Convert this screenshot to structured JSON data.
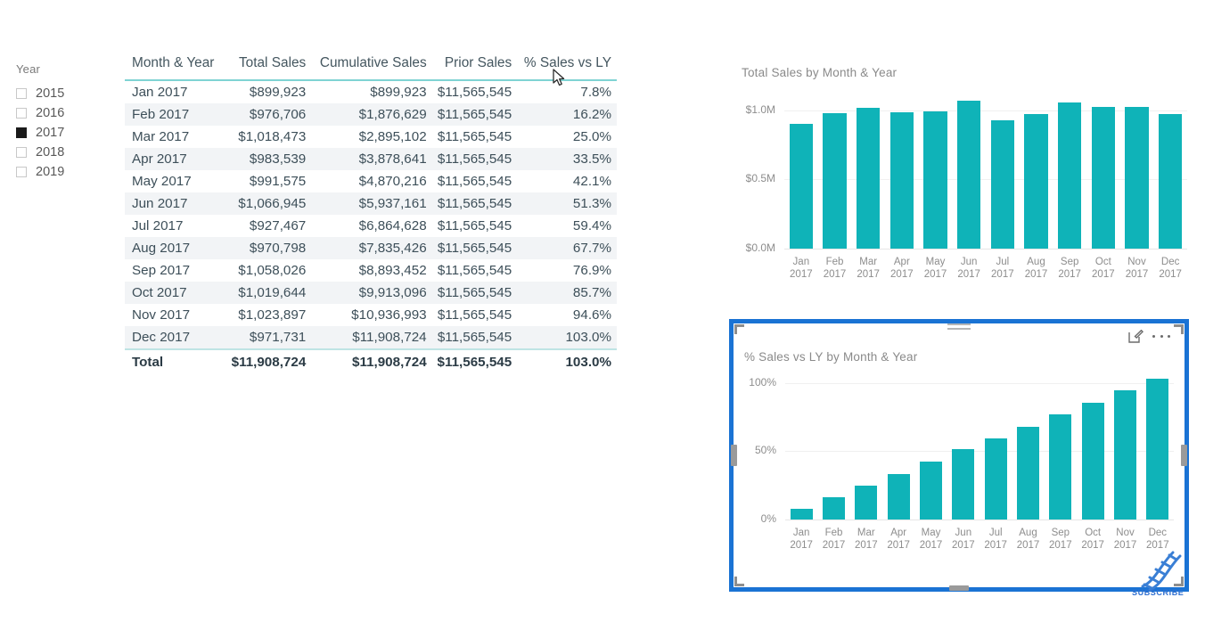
{
  "slicer": {
    "title": "Year",
    "items": [
      {
        "label": "2015",
        "checked": false
      },
      {
        "label": "2016",
        "checked": false
      },
      {
        "label": "2017",
        "checked": true
      },
      {
        "label": "2018",
        "checked": false
      },
      {
        "label": "2019",
        "checked": false
      }
    ]
  },
  "table": {
    "headers": [
      "Month & Year",
      "Total Sales",
      "Cumulative Sales",
      "Prior Sales",
      "% Sales vs LY"
    ],
    "rows": [
      [
        "Jan 2017",
        "$899,923",
        "$899,923",
        "$11,565,545",
        "7.8%"
      ],
      [
        "Feb 2017",
        "$976,706",
        "$1,876,629",
        "$11,565,545",
        "16.2%"
      ],
      [
        "Mar 2017",
        "$1,018,473",
        "$2,895,102",
        "$11,565,545",
        "25.0%"
      ],
      [
        "Apr 2017",
        "$983,539",
        "$3,878,641",
        "$11,565,545",
        "33.5%"
      ],
      [
        "May 2017",
        "$991,575",
        "$4,870,216",
        "$11,565,545",
        "42.1%"
      ],
      [
        "Jun 2017",
        "$1,066,945",
        "$5,937,161",
        "$11,565,545",
        "51.3%"
      ],
      [
        "Jul 2017",
        "$927,467",
        "$6,864,628",
        "$11,565,545",
        "59.4%"
      ],
      [
        "Aug 2017",
        "$970,798",
        "$7,835,426",
        "$11,565,545",
        "67.7%"
      ],
      [
        "Sep 2017",
        "$1,058,026",
        "$8,893,452",
        "$11,565,545",
        "76.9%"
      ],
      [
        "Oct 2017",
        "$1,019,644",
        "$9,913,096",
        "$11,565,545",
        "85.7%"
      ],
      [
        "Nov 2017",
        "$1,023,897",
        "$10,936,993",
        "$11,565,545",
        "94.6%"
      ],
      [
        "Dec 2017",
        "$971,731",
        "$11,908,724",
        "$11,565,545",
        "103.0%"
      ]
    ],
    "total_row": [
      "Total",
      "$11,908,724",
      "$11,908,724",
      "$11,565,545",
      "103.0%"
    ]
  },
  "visual_header": {
    "focus_icon": "focus-mode-icon",
    "more_icon": "more-options-icon"
  },
  "watermark": {
    "logo": "dna-helix-icon",
    "text": "SUBSCRIBE"
  },
  "cursor": {
    "icon": "mouse-pointer-icon"
  },
  "colors": {
    "bar": "#0fb3b8",
    "selection": "#1a73d4",
    "header_rule": "#7fd3d3",
    "band": "#f2f4f6"
  },
  "chart_data": [
    {
      "id": "total_sales_by_month",
      "type": "bar",
      "title": "Total Sales by Month & Year",
      "xlabel": "",
      "ylabel": "",
      "categories": [
        "Jan\n2017",
        "Feb\n2017",
        "Mar\n2017",
        "Apr\n2017",
        "May\n2017",
        "Jun\n2017",
        "Jul\n2017",
        "Aug\n2017",
        "Sep\n2017",
        "Oct\n2017",
        "Nov\n2017",
        "Dec\n2017"
      ],
      "values": [
        899923,
        976706,
        1018473,
        983539,
        991575,
        1066945,
        927467,
        970798,
        1058026,
        1019644,
        1023897,
        971731
      ],
      "ylim": [
        0,
        1100000
      ],
      "yticks": [
        0,
        500000,
        1000000
      ],
      "ytick_labels": [
        "$0.0M",
        "$0.5M",
        "$1.0M"
      ],
      "grid": true,
      "legend": "none",
      "color": "#0fb3b8"
    },
    {
      "id": "pct_sales_vs_ly_by_month",
      "type": "bar",
      "title": "% Sales vs LY by Month & Year",
      "xlabel": "",
      "ylabel": "",
      "categories": [
        "Jan\n2017",
        "Feb\n2017",
        "Mar\n2017",
        "Apr\n2017",
        "May\n2017",
        "Jun\n2017",
        "Jul\n2017",
        "Aug\n2017",
        "Sep\n2017",
        "Oct\n2017",
        "Nov\n2017",
        "Dec\n2017"
      ],
      "values": [
        7.8,
        16.2,
        25.0,
        33.5,
        42.1,
        51.3,
        59.4,
        67.7,
        76.9,
        85.7,
        94.6,
        103.0
      ],
      "ylim": [
        0,
        103.0
      ],
      "yticks": [
        0,
        50,
        100
      ],
      "ytick_labels": [
        "0%",
        "50%",
        "100%"
      ],
      "grid": true,
      "legend": "none",
      "color": "#0fb3b8"
    }
  ]
}
